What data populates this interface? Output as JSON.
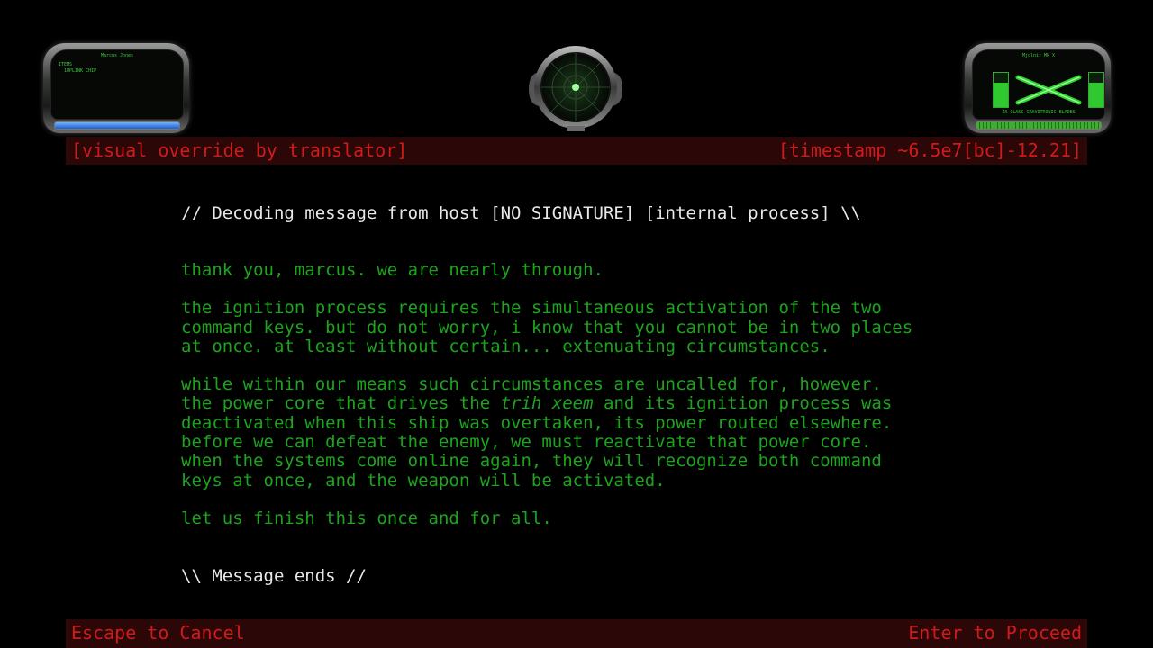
{
  "hud_left": {
    "title": "Marcus Jones",
    "items_heading": "ITEMS",
    "items": [
      "1UPLINK CHIP"
    ],
    "bar_color": "#3a7fe8"
  },
  "hud_right": {
    "title": "Mjolnir Mk X",
    "weapon_name": "ZX-CLASS GRAVITRONIC BLADES",
    "icon": "crossed-blades-icon",
    "bar_color": "#39b12a"
  },
  "radar": {
    "icon": "radar-icon"
  },
  "banner_top": {
    "left": "[visual override by translator]",
    "right": "[timestamp ~6.5e7[bc]-12.21]"
  },
  "message": {
    "header": "// Decoding message from host [NO SIGNATURE] [internal process] \\\\",
    "paragraphs": [
      [
        "thank you, marcus. we are nearly through."
      ],
      [
        "the ignition process requires the simultaneous activation of the two",
        "command keys. but do not worry, i know that you cannot be in two places",
        "at once. at least without certain... extenuating circumstances."
      ],
      [
        "while within our means such circumstances are uncalled for, however.",
        "the power core that drives the |trih xeem| and its ignition process was",
        "deactivated when this ship was overtaken, its power routed elsewhere.",
        "before we can defeat the enemy, we must reactivate that power core.",
        "when the systems come online again, they will recognize both command",
        "keys at once, and the weapon will be activated."
      ],
      [
        "let us finish this once and for all."
      ]
    ],
    "footer": "\\\\ Message ends //"
  },
  "banner_bottom": {
    "left": "Escape to Cancel",
    "right": "Enter to Proceed"
  },
  "colors": {
    "message_text": "#1ca41c",
    "banner_text": "#d21a1a",
    "banner_bg": "#2c0707",
    "header_text": "#e8e8e8"
  }
}
